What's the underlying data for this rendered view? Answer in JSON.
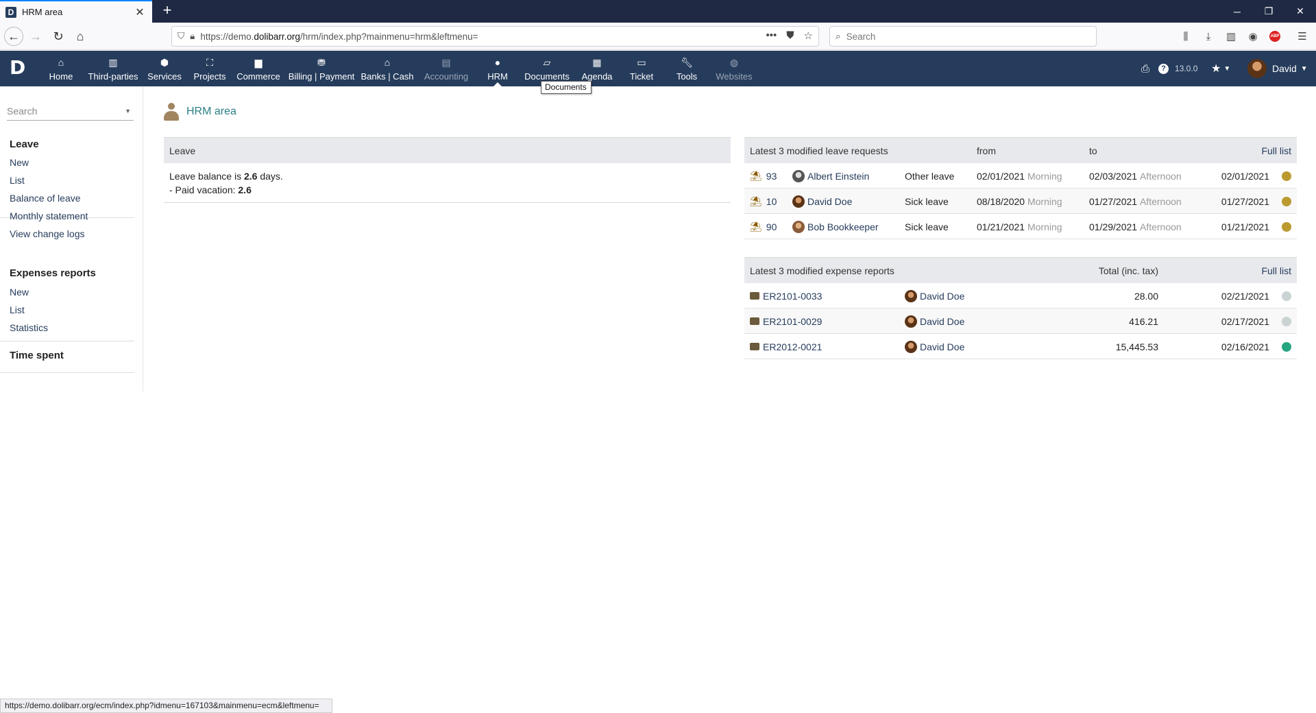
{
  "browser": {
    "tab_title": "HRM area",
    "url_prefix": "https://demo.",
    "url_domain": "dolibarr.org",
    "url_path": "/hrm/index.php?mainmenu=hrm&leftmenu=",
    "search_placeholder": "Search",
    "status_url": "https://demo.dolibarr.org/ecm/index.php?idmenu=167103&mainmenu=ecm&leftmenu="
  },
  "topmenu": {
    "items": [
      {
        "label": "Home",
        "icon": "home-icon"
      },
      {
        "label": "Third-parties",
        "icon": "building-icon"
      },
      {
        "label": "Services",
        "icon": "cube-icon"
      },
      {
        "label": "Projects",
        "icon": "sitemap-icon"
      },
      {
        "label": "Commerce",
        "icon": "suitcase-icon"
      },
      {
        "label": "Billing | Payment",
        "icon": "coins-icon"
      },
      {
        "label": "Banks | Cash",
        "icon": "bank-icon"
      },
      {
        "label": "Accounting",
        "icon": "ledger-icon"
      },
      {
        "label": "HRM",
        "icon": "user-tie-icon"
      },
      {
        "label": "Documents",
        "icon": "folder-open-icon"
      },
      {
        "label": "Agenda",
        "icon": "calendar-icon"
      },
      {
        "label": "Ticket",
        "icon": "ticket-icon"
      },
      {
        "label": "Tools",
        "icon": "wrench-icon"
      },
      {
        "label": "Websites",
        "icon": "globe-icon"
      }
    ],
    "tooltip": "Documents",
    "version": "13.0.0",
    "user": "David"
  },
  "leftmenu": {
    "search_placeholder": "Search",
    "leave": {
      "title": "Leave",
      "items": [
        "New",
        "List",
        "Balance of leave",
        "Monthly statement",
        "View change logs"
      ]
    },
    "expenses": {
      "title": "Expenses reports",
      "items": [
        "New",
        "List",
        "Statistics"
      ]
    },
    "time_spent": {
      "title": "Time spent"
    }
  },
  "page": {
    "title": "HRM area"
  },
  "leave_panel": {
    "header": "Leave",
    "balance_prefix": "Leave balance is ",
    "balance_value": "2.6",
    "balance_suffix": " days.",
    "paid_prefix": "- Paid vacation: ",
    "paid_value": "2.6"
  },
  "leave_requests": {
    "header": "Latest 3 modified leave requests",
    "col_from": "from",
    "col_to": "to",
    "full_list": "Full list",
    "status_color": "#bb9a2f",
    "rows": [
      {
        "ref": "93",
        "user": "Albert Einstein",
        "type": "Other leave",
        "from_date": "02/01/2021",
        "from_half": "Morning",
        "to_date": "02/03/2021",
        "to_half": "Afternoon",
        "date": "02/01/2021"
      },
      {
        "ref": "10",
        "user": "David Doe",
        "type": "Sick leave",
        "from_date": "08/18/2020",
        "from_half": "Morning",
        "to_date": "01/27/2021",
        "to_half": "Afternoon",
        "date": "01/27/2021"
      },
      {
        "ref": "90",
        "user": "Bob Bookkeeper",
        "type": "Sick leave",
        "from_date": "01/21/2021",
        "from_half": "Morning",
        "to_date": "01/29/2021",
        "to_half": "Afternoon",
        "date": "01/21/2021"
      }
    ]
  },
  "expense_reports": {
    "header": "Latest 3 modified expense reports",
    "col_total": "Total (inc. tax)",
    "full_list": "Full list",
    "rows": [
      {
        "ref": "ER2101-0033",
        "user": "David Doe",
        "total": "28.00",
        "date": "02/21/2021",
        "status_color": "#c9d3d3"
      },
      {
        "ref": "ER2101-0029",
        "user": "David Doe",
        "total": "416.21",
        "date": "02/17/2021",
        "status_color": "#c9d3d3"
      },
      {
        "ref": "ER2012-0021",
        "user": "David Doe",
        "total": "15,445.53",
        "date": "02/16/2021",
        "status_color": "#25a580"
      }
    ]
  }
}
